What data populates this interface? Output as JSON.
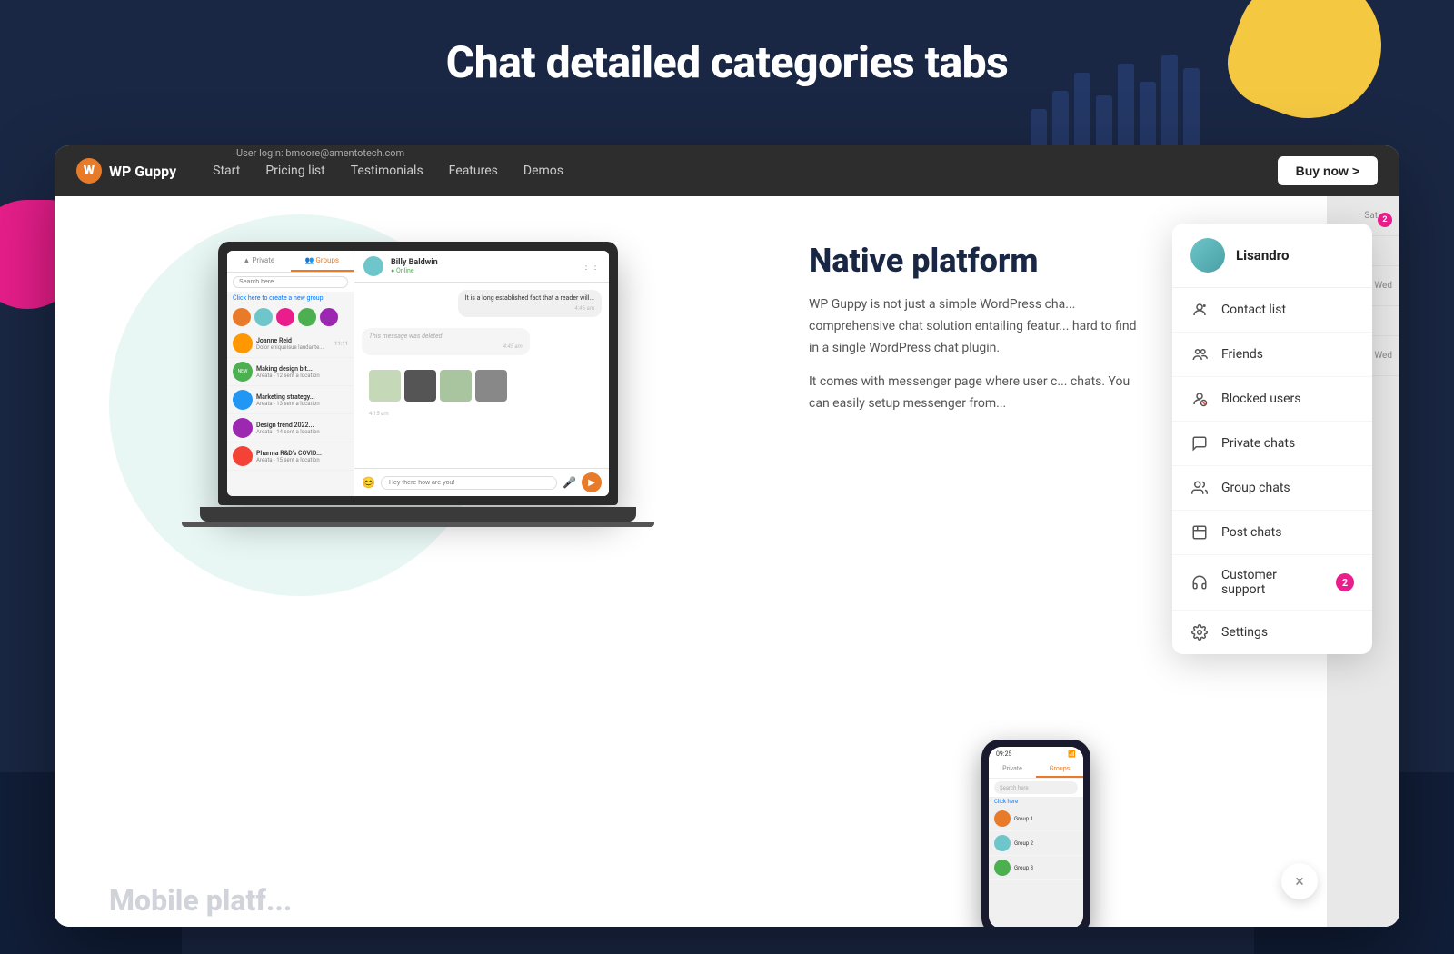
{
  "page": {
    "heading": "Chat detailed categories tabs",
    "background_color": "#1a2744"
  },
  "nav": {
    "user_login": "User login: bmoore@amentotech.com",
    "logo_text": "WP Guppy",
    "links": [
      {
        "label": "Start",
        "active": false
      },
      {
        "label": "Pricing list",
        "active": false
      },
      {
        "label": "Testimonials",
        "active": false
      },
      {
        "label": "Features",
        "active": false
      },
      {
        "label": "Demos",
        "active": false
      }
    ],
    "buy_button": "Buy now >"
  },
  "chat_ui": {
    "tabs": [
      {
        "label": "Private",
        "active": false
      },
      {
        "label": "Groups",
        "active": true
      }
    ],
    "search_placeholder": "Search here",
    "create_group_text": "Click here to create a new group",
    "header_name": "Billy Baldwin",
    "header_status": "Online",
    "messages": [
      {
        "text": "It is a long established fact that a reader will...",
        "type": "received",
        "time": "4:45 am"
      },
      {
        "text": "This message was deleted",
        "type": "deleted",
        "time": "4:45 am"
      },
      {
        "text": "Hey there how are you!",
        "type": "sent"
      }
    ],
    "chat_list": [
      {
        "name": "Joanne Reid",
        "msg": "Dolor eniqueisue laudante...",
        "time": "11:11"
      },
      {
        "name": "Making design bit...",
        "msg": "Areata - 12 sent a location",
        "time": ""
      },
      {
        "name": "Marketing strategy...",
        "msg": "Areata - 13 sent a location",
        "time": ""
      },
      {
        "name": "Design trend 2022...",
        "msg": "Areata - 14 sent a location",
        "time": ""
      },
      {
        "name": "Pharma R&D's COVID...",
        "msg": "Areata - 15 sent a location",
        "time": ""
      }
    ],
    "input_placeholder": "This message was deleted"
  },
  "main_content": {
    "title": "Native platform",
    "description1": "WP Guppy is not just a simple WordPress cha... comprehensive chat solution entailing featur... hard to find in a single WordPress chat plugin.",
    "description2": "It comes with messenger page where user c... chats. You can easily setup messenger from..."
  },
  "dropdown": {
    "username": "Lisandro",
    "items": [
      {
        "label": "Contact list",
        "icon": "contact-icon"
      },
      {
        "label": "Friends",
        "icon": "friends-icon"
      },
      {
        "label": "Blocked users",
        "icon": "block-icon"
      },
      {
        "label": "Private chats",
        "icon": "chat-icon"
      },
      {
        "label": "Group chats",
        "icon": "group-chat-icon"
      },
      {
        "label": "Post chats",
        "icon": "post-chat-icon"
      },
      {
        "label": "Customer support",
        "icon": "support-icon",
        "badge": "2"
      },
      {
        "label": "Settings",
        "icon": "settings-icon"
      }
    ]
  },
  "side_panel": {
    "items": [
      {
        "label": "Sat",
        "badge": "2"
      },
      {
        "label": ""
      },
      {
        "label": "Wed"
      },
      {
        "label": ""
      },
      {
        "label": "Wed"
      }
    ]
  },
  "phone": {
    "time": "09:25",
    "tabs": [
      {
        "label": "Private",
        "active": false
      },
      {
        "label": "Groups",
        "active": true
      }
    ],
    "search_placeholder": "Search here",
    "create_group": "Click here"
  },
  "close_button": "×",
  "mobile_platform_text": "Mobile platf..."
}
